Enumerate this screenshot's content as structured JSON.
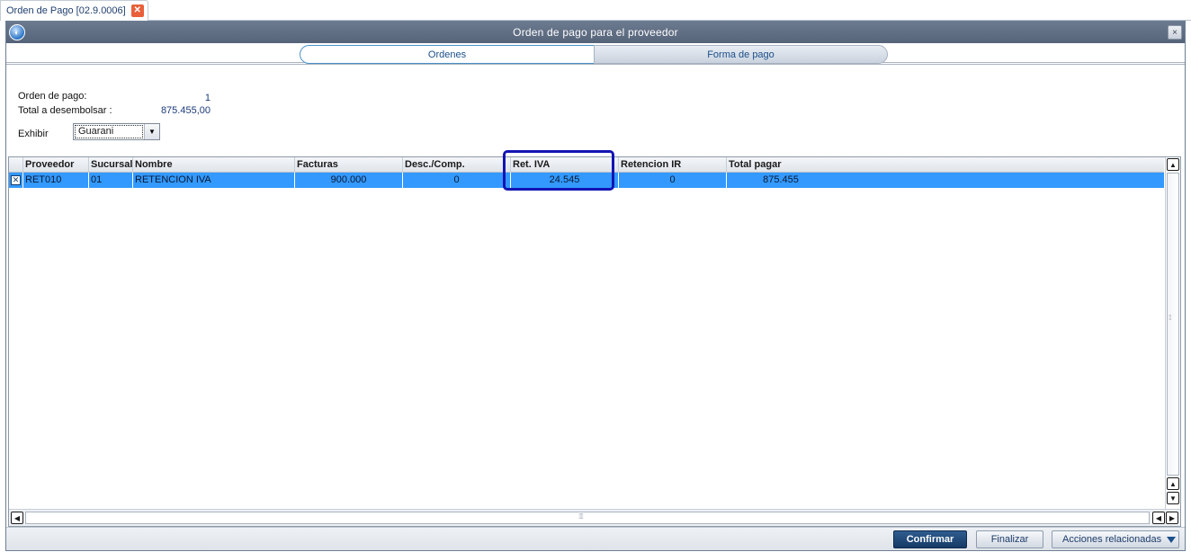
{
  "doc_tab": {
    "label": "Orden de Pago [02.9.0006]",
    "close_glyph": "✕"
  },
  "window": {
    "title": "Orden de pago para el proveedor",
    "close_glyph": "×"
  },
  "folder_tabs": [
    {
      "label": "Ordenes",
      "active": true
    },
    {
      "label": "Forma de pago",
      "active": false
    }
  ],
  "header": {
    "orden_label": "Orden de pago:",
    "orden_value": "1",
    "total_label": "Total a desembolsar :",
    "total_value": "875.455,00",
    "exhibir_label": "Exhibir",
    "exhibir_value": "Guarani"
  },
  "grid": {
    "columns": [
      "Proveedor",
      "Sucursal",
      "Nombre",
      "Facturas",
      "Desc./Comp.",
      "Ret. IVA",
      "Retencion IR",
      "Total pagar"
    ],
    "rows": [
      {
        "checked": true,
        "cells": [
          "RET010",
          "01",
          "RETENCION IVA",
          "900.000",
          "0",
          "24.545",
          "0",
          "875.455"
        ]
      }
    ],
    "highlight_column": "Ret. IVA"
  },
  "footer": {
    "confirm_label": "Confirmar",
    "finish_label": "Finalizar",
    "actions_label": "Acciones relacionadas"
  },
  "colors": {
    "title_bar": "#5f6d83",
    "selected_row": "#3399ff",
    "highlight_border": "#1414b4",
    "primary_button": "#1f4675",
    "close_tab": "#e8603a"
  }
}
